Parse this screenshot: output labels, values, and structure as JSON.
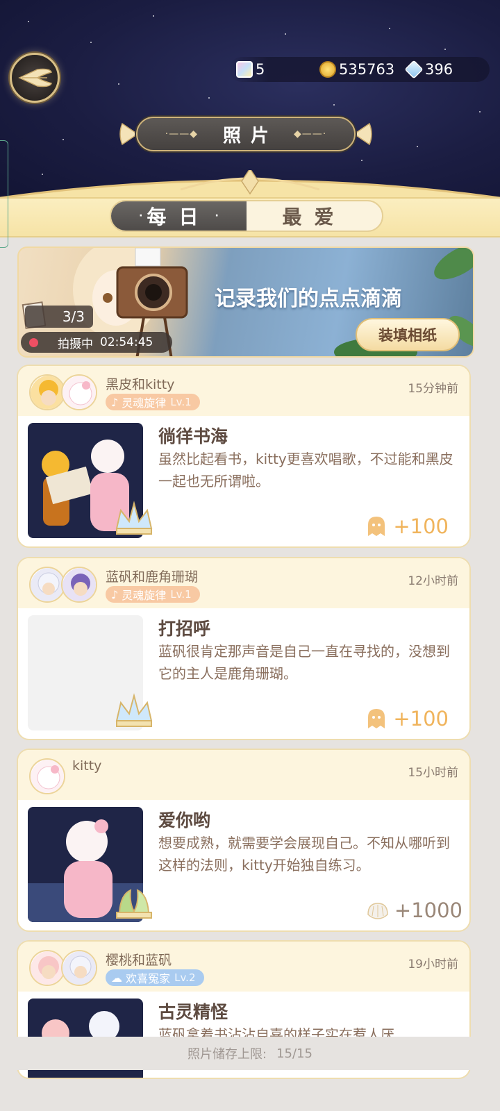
{
  "header": {
    "title": "照片",
    "resources": {
      "film_count": "5",
      "coins": "535763",
      "gems": "396"
    }
  },
  "tabs": [
    {
      "label": "每日",
      "active": true
    },
    {
      "label": "最爱",
      "active": false
    }
  ],
  "banner": {
    "slogan": "记录我们的点点滴滴",
    "roll_count": "3/3",
    "shoot_status_label": "拍摄中",
    "shoot_timer": "02:54:45",
    "fill_button": "装填相纸"
  },
  "cards": [
    {
      "names": "黑皮和kitty",
      "badge": "灵魂旋律",
      "badge_level": "Lv.1",
      "time": "15分钟前",
      "title": "徜徉书海",
      "description": "虽然比起看书，kitty更喜欢唱歌，不过能和黑皮一起也无所谓啦。",
      "reward": "+100"
    },
    {
      "names": "蓝矾和鹿角珊瑚",
      "badge": "灵魂旋律",
      "badge_level": "Lv.1",
      "time": "12小时前",
      "title": "打招呼",
      "description": "蓝矾很肯定那声音是自己一直在寻找的，没想到它的主人是鹿角珊瑚。",
      "reward": "+100"
    },
    {
      "names": "kitty",
      "time": "15小时前",
      "title": "爱你哟",
      "description": "想要成熟，就需要学会展现自己。不知从哪听到这样的法则，kitty开始独自练习。",
      "reward": "+1000"
    },
    {
      "names": "樱桃和蓝矾",
      "badge": "欢喜冤家",
      "badge_level": "Lv.2",
      "time": "19小时前",
      "title": "古灵精怪",
      "description": "蓝矾拿着书沾沾自喜的样子实在惹人厌"
    }
  ],
  "footer": {
    "capacity_label": "照片储存上限:",
    "capacity_value": "15/15"
  },
  "colors": {
    "accent_gold": "#f0b45c",
    "tab_active_bg": "#5b5856",
    "header_band": "#f6e3a6"
  }
}
